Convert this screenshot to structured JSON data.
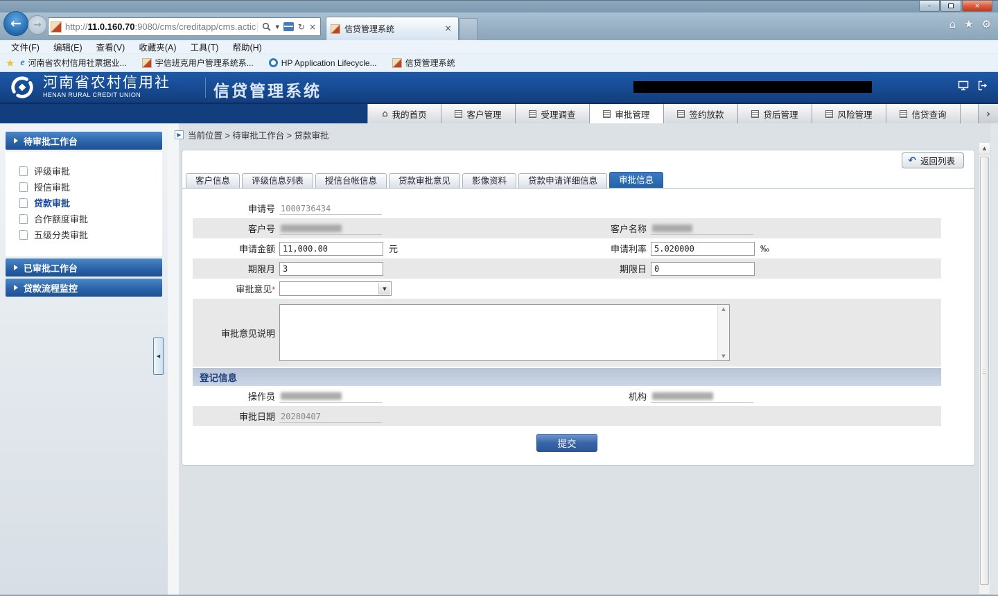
{
  "colors": {
    "brand_header_blue": "#123e7d",
    "nav_active_tab_bg": "#ffffff",
    "detail_tab_active_bg": "#2b68ae",
    "section_bar_bg": "#c2cedf",
    "submit_button_bg": "#3a66a8",
    "required_asterisk": "#cc2b2b",
    "active_sidebar_text": "#14459c"
  },
  "icons": {
    "back": "←",
    "forward": "→",
    "refresh": "↻",
    "close": "×",
    "home": "⌂",
    "star": "★",
    "gear": "⚙",
    "dropdown": "▼",
    "scroll_up": "▲",
    "scroll_down": "▼",
    "collapse_left": "◀",
    "return_arrow": "↶",
    "nav_overflow": "›",
    "fav_star": "★",
    "ie_e": "e",
    "minimize": "–",
    "breadcrumb_arrow": "▶"
  },
  "browser": {
    "url": {
      "prefix": "http://",
      "host": "11.0.160.70",
      "path": ":9080/cms/creditapp/cms.actic"
    },
    "tab_title": "信贷管理系统",
    "menu_items": [
      "文件(F)",
      "编辑(E)",
      "查看(V)",
      "收藏夹(A)",
      "工具(T)",
      "帮助(H)"
    ],
    "favorites": [
      "河南省农村信用社票据业...",
      "宇信班克用户管理系统系...",
      "HP Application Lifecycle...",
      "信贷管理系统"
    ]
  },
  "app_header": {
    "org_cn": "河南省农村信用社",
    "org_en": "HENAN RURAL CREDIT UNION",
    "system": "信贷管理系统"
  },
  "nav_tabs": [
    "我的首页",
    "客户管理",
    "受理调查",
    "审批管理",
    "签约放款",
    "贷后管理",
    "风险管理",
    "信贷查询"
  ],
  "sidebar": {
    "sections": [
      {
        "title": "待审批工作台",
        "items": [
          "评级审批",
          "授信审批",
          "贷款审批",
          "合作额度审批",
          "五级分类审批"
        ],
        "active_item": "贷款审批"
      },
      {
        "title": "已审批工作台"
      },
      {
        "title": "贷款流程监控"
      }
    ]
  },
  "breadcrumb": "当前位置 > 待审批工作台 > 贷款审批",
  "page": {
    "back_to_list": "返回列表",
    "detail_tabs": [
      "客户信息",
      "评级信息列表",
      "授信台帐信息",
      "贷款审批意见",
      "影像资料",
      "贷款申请详细信息",
      "审批信息"
    ],
    "active_detail_tab": "审批信息",
    "form": {
      "apply_no": {
        "label": "申请号",
        "value": "1000736434"
      },
      "customer_no": {
        "label": "客户号",
        "value": "",
        "redacted": true
      },
      "customer_name": {
        "label": "客户名称",
        "value": "",
        "redacted": true
      },
      "apply_amount": {
        "label": "申请金额",
        "value": "11,000.00",
        "unit": "元"
      },
      "apply_rate": {
        "label": "申请利率",
        "value": "5.020000",
        "unit": "‰"
      },
      "term_month": {
        "label": "期限月",
        "value": "3"
      },
      "term_day": {
        "label": "期限日",
        "value": "0"
      },
      "approval_opinion": {
        "label": "审批意见",
        "required": "*",
        "value": ""
      },
      "approval_opinion_desc": {
        "label": "审批意见说明",
        "value": ""
      }
    },
    "register": {
      "title": "登记信息",
      "operator": {
        "label": "操作员",
        "value": "",
        "redacted": true
      },
      "org": {
        "label": "机构",
        "value": "",
        "redacted": true
      },
      "approval_date": {
        "label": "审批日期",
        "value": "20280407"
      }
    },
    "submit": "提交"
  }
}
